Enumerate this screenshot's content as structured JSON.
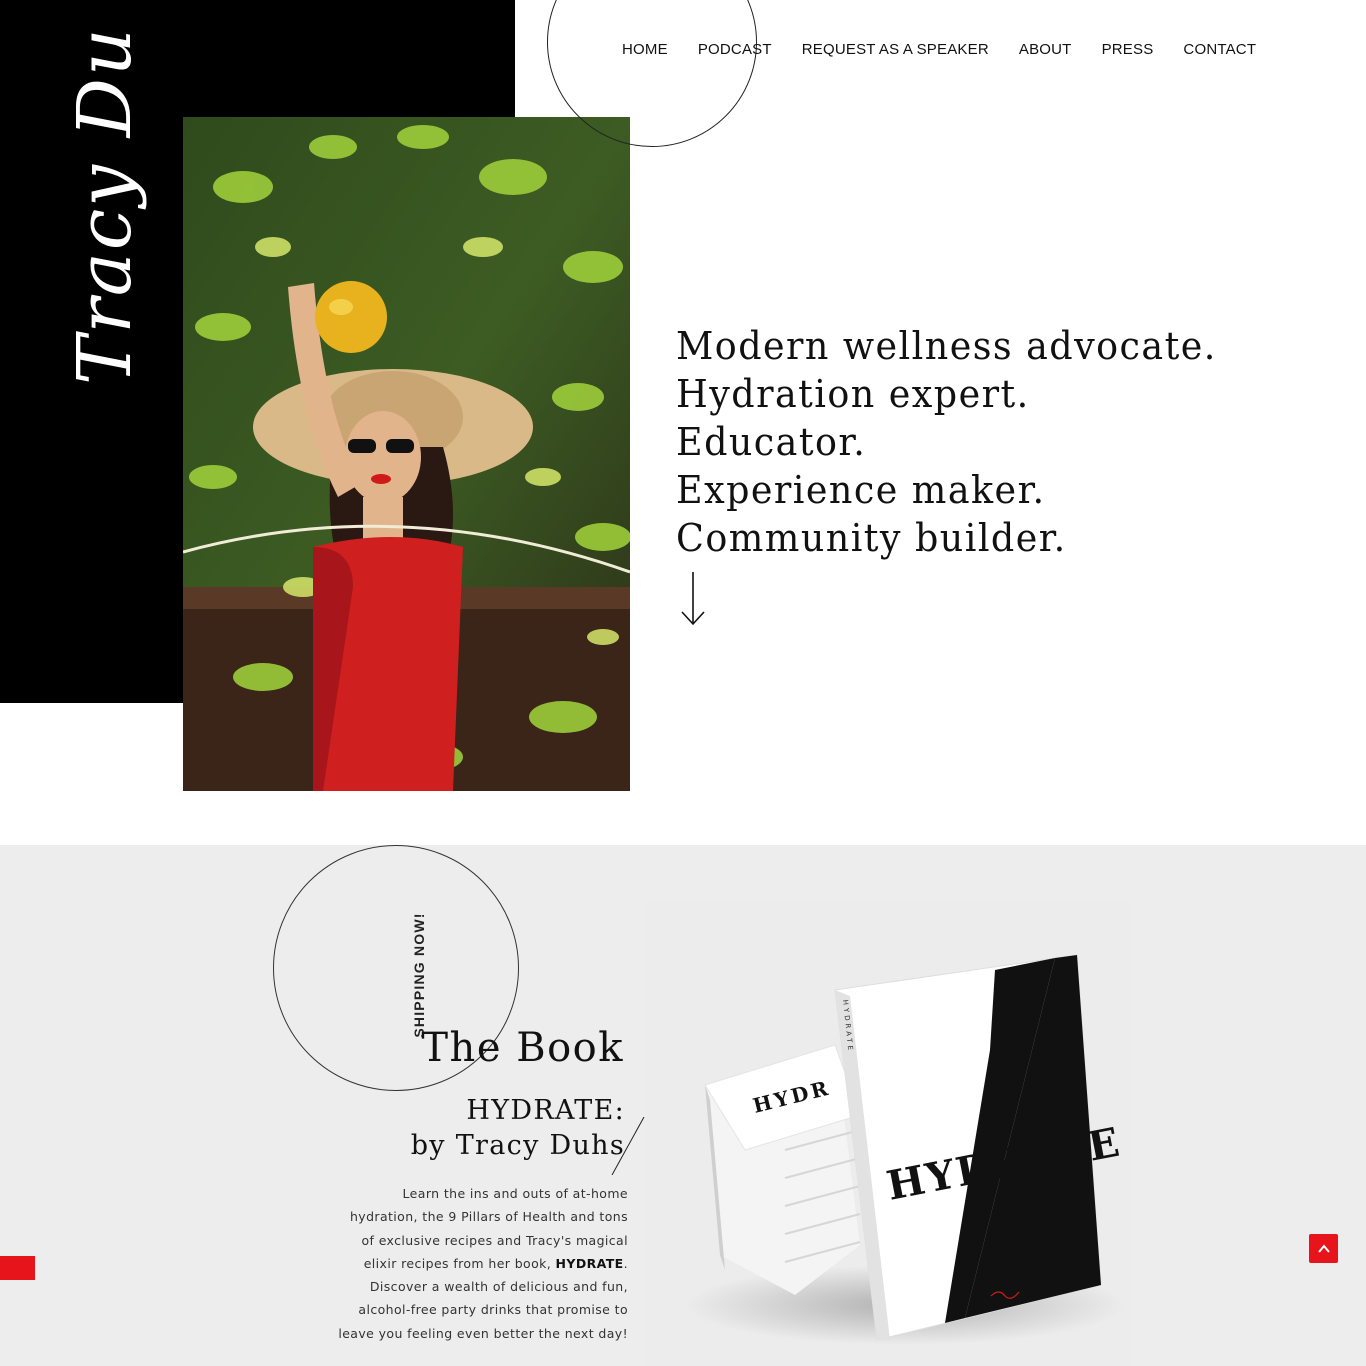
{
  "brand": {
    "signature_text": "Tracy Duhs"
  },
  "nav": {
    "items": [
      {
        "label": "HOME"
      },
      {
        "label": "PODCAST"
      },
      {
        "label": "REQUEST AS A SPEAKER"
      },
      {
        "label": "ABOUT"
      },
      {
        "label": "PRESS"
      },
      {
        "label": "CONTACT"
      }
    ]
  },
  "hero": {
    "tagline_lines": [
      "Modern wellness advocate.",
      "Hydration expert.",
      "Educator.",
      "Experience maker.",
      "Community builder."
    ]
  },
  "book": {
    "badge": "SHIPPING NOW!",
    "heading": "The Book",
    "subtitle_line1": "HYDRATE:",
    "subtitle_line2": "by Tracy Duhs",
    "description_bold": "HYDRATE",
    "description_before": "Learn the ins and outs of at-home hydration, the 9 Pillars of Health and tons of exclusive recipes and Tracy's magical elixir recipes from her book,",
    "description_after": ". Discover a wealth of delicious and fun, alcohol-free party drinks that promise to leave you feeling even better the next day!",
    "cover_title": "HYDRATE",
    "spine_title": "HYDRATE",
    "stack_title": "HYDR"
  },
  "colors": {
    "accent_red": "#e8141b",
    "panel_black": "#000000",
    "section_gray": "#ededed"
  },
  "icons": {
    "scroll_top": "chevron-up-icon",
    "scroll_hint": "arrow-down-icon"
  }
}
